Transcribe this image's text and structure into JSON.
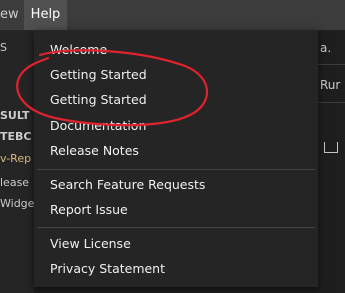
{
  "menubar": {
    "items": [
      "ew",
      "Help"
    ]
  },
  "background_left": {
    "lines": [
      "S",
      "SULT",
      "TEBC",
      "v-Rep",
      "lease",
      "Widge"
    ]
  },
  "background_right": {
    "lines": [
      "a.",
      "Rur"
    ]
  },
  "help_menu": {
    "groups": [
      [
        "Welcome",
        "Getting Started",
        "Getting Started",
        "Documentation",
        "Release Notes"
      ],
      [
        "Search Feature Requests",
        "Report Issue"
      ],
      [
        "View License",
        "Privacy Statement"
      ]
    ]
  },
  "colors": {
    "accent_text": "#d7ba7d",
    "annotation": "#e0232e"
  }
}
